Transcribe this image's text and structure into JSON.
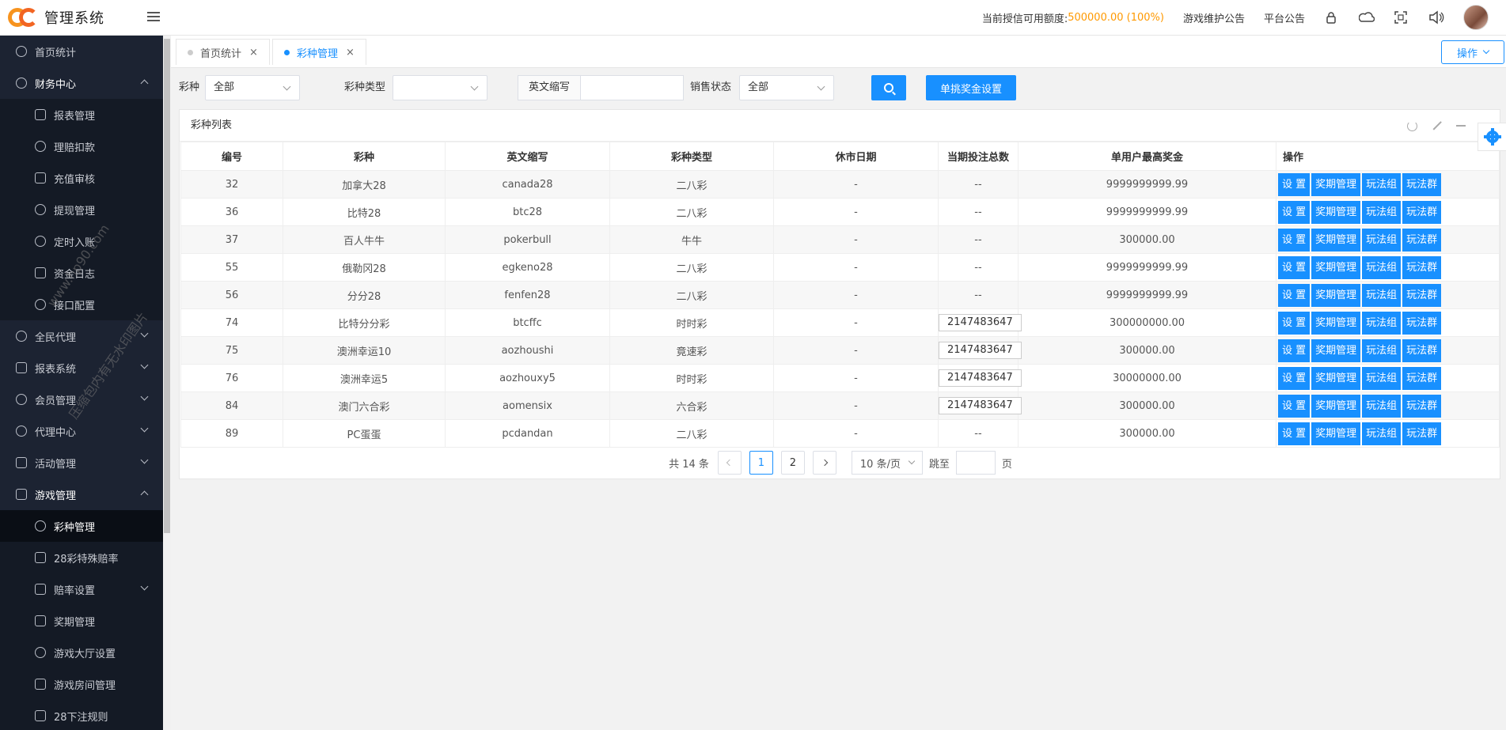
{
  "header": {
    "app_title": "管理系统",
    "credit_label": "当前授信可用额度:",
    "credit_value": "500000.00 (100%)",
    "links": [
      "游戏维护公告",
      "平台公告"
    ]
  },
  "sidebar": {
    "top": {
      "label": "首页统计"
    },
    "finance": {
      "label": "财务中心",
      "items": [
        "报表管理",
        "理赔扣款",
        "充值审核",
        "提现管理",
        "定时入账",
        "资金日志",
        "接口配置"
      ]
    },
    "groups_mid": [
      "全民代理",
      "报表系统",
      "会员管理",
      "代理中心",
      "活动管理"
    ],
    "game": {
      "label": "游戏管理",
      "items": [
        "彩种管理",
        "28彩特殊赔率",
        "赔率设置",
        "奖期管理",
        "游戏大厅设置",
        "游戏房间管理",
        "28下注规则"
      ]
    }
  },
  "tabs": [
    {
      "label": "首页统计",
      "close": "×"
    },
    {
      "label": "彩种管理",
      "close": "×"
    }
  ],
  "op_button": "操作",
  "filter": {
    "lottery_label": "彩种",
    "lottery_value": "全部",
    "type_label": "彩种类型",
    "type_value": "",
    "abbr_label": "英文缩写",
    "abbr_value": "",
    "sale_label": "销售状态",
    "sale_value": "全部",
    "bonus_button": "单挑奖金设置"
  },
  "panel_title": "彩种列表",
  "table": {
    "headers": [
      "编号",
      "彩种",
      "英文缩写",
      "彩种类型",
      "休市日期",
      "当期投注总数",
      "单用户最高奖金",
      "操作"
    ],
    "actions": [
      "设 置",
      "奖期管理",
      "玩法组",
      "玩法群"
    ],
    "rows": [
      {
        "id": "32",
        "name": "加拿大28",
        "abbr": "canada28",
        "type": "二八彩",
        "closed": "-",
        "bets": "--",
        "max_bonus": "9999999999.99"
      },
      {
        "id": "36",
        "name": "比特28",
        "abbr": "btc28",
        "type": "二八彩",
        "closed": "-",
        "bets": "--",
        "max_bonus": "9999999999.99"
      },
      {
        "id": "37",
        "name": "百人牛牛",
        "abbr": "pokerbull",
        "type": "牛牛",
        "closed": "-",
        "bets": "--",
        "max_bonus": "300000.00"
      },
      {
        "id": "55",
        "name": "俄勒冈28",
        "abbr": "egkeno28",
        "type": "二八彩",
        "closed": "-",
        "bets": "--",
        "max_bonus": "9999999999.99"
      },
      {
        "id": "56",
        "name": "分分28",
        "abbr": "fenfen28",
        "type": "二八彩",
        "closed": "-",
        "bets": "--",
        "max_bonus": "9999999999.99"
      },
      {
        "id": "74",
        "name": "比特分分彩",
        "abbr": "btcffc",
        "type": "时时彩",
        "closed": "-",
        "bets": "2147483647",
        "max_bonus": "300000000.00"
      },
      {
        "id": "75",
        "name": "澳洲幸运10",
        "abbr": "aozhoushi",
        "type": "竟速彩",
        "closed": "-",
        "bets": "2147483647",
        "max_bonus": "300000.00"
      },
      {
        "id": "76",
        "name": "澳洲幸运5",
        "abbr": "aozhouxy5",
        "type": "时时彩",
        "closed": "-",
        "bets": "2147483647",
        "max_bonus": "30000000.00"
      },
      {
        "id": "84",
        "name": "澳门六合彩",
        "abbr": "aomensix",
        "type": "六合彩",
        "closed": "-",
        "bets": "2147483647",
        "max_bonus": "300000.00"
      },
      {
        "id": "89",
        "name": "PC蛋蛋",
        "abbr": "pcdandan",
        "type": "二八彩",
        "closed": "-",
        "bets": "--",
        "max_bonus": "300000.00"
      }
    ]
  },
  "pager": {
    "total": "共 14 条",
    "pages": [
      "1",
      "2"
    ],
    "page_size": "10 条/页",
    "jump_label": "跳至",
    "page_suffix": "页"
  },
  "watermark": {
    "line1": "www.hp90.com",
    "line2": "压缩包内有无水印图片"
  },
  "colors": {
    "accent": "#1890ff",
    "credit": "#ff9900",
    "sidebar_bg": "#1c2332"
  }
}
